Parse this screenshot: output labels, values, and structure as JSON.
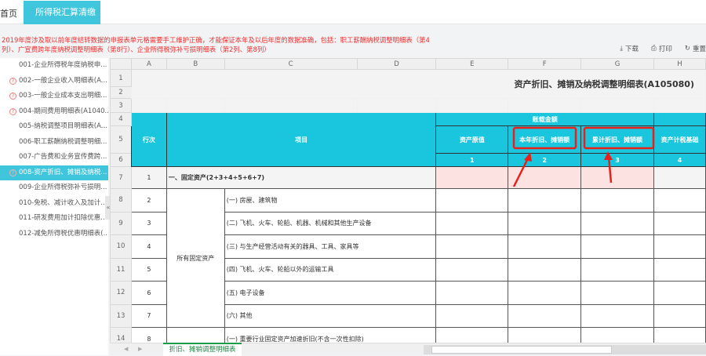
{
  "tabs": {
    "home": "首页",
    "active": "所得税汇算清缴",
    "close": "×"
  },
  "warning": "2019年度涉及取以前年度结转数据的申报表单元格需要手工维护正确，才能保证本年及以后年度的数据准确，包括：职工薪酬纳税调整明细表（第4列）、广宣费跨年度纳税调整明细表（第8行）、企业所得税弥补亏损明细表（第2列、第8列）",
  "toolbar": {
    "download": "下载",
    "print": "打印",
    "reset": "重置"
  },
  "sidebar": {
    "items": [
      {
        "label": "001-企业所得税年度纳税申...",
        "warn": false
      },
      {
        "label": "002-一般企业收入明细表(A...",
        "warn": true
      },
      {
        "label": "003-一般企业成本支出明细...",
        "warn": true
      },
      {
        "label": "004-期间费用明细表(A1040...",
        "warn": true
      },
      {
        "label": "005-纳税调整项目明细表(A...",
        "warn": false
      },
      {
        "label": "006-职工薪酬纳税调整明细...",
        "warn": false
      },
      {
        "label": "007-广告费和业务宣传费跨...",
        "warn": false
      },
      {
        "label": "008-资产折旧、摊销及纳税...",
        "warn": true,
        "active": true
      },
      {
        "label": "009-企业所得税弥补亏损明...",
        "warn": false
      },
      {
        "label": "010-免税、减计收入及加计...",
        "warn": false
      },
      {
        "label": "011-研发费用加计扣除优惠...",
        "warn": false
      },
      {
        "label": "012-减免所得税优惠明细表(...",
        "warn": false
      }
    ],
    "collapse": "«"
  },
  "sheet": {
    "columns": [
      "A",
      "B",
      "C",
      "D",
      "E",
      "F",
      "G",
      "H"
    ],
    "title": "资产折旧、摊销及纳税调整明细表(A105080)",
    "header": {
      "line_no": "行次",
      "item": "项目",
      "group": "账载金额",
      "cols": [
        "资产原值",
        "本年折旧、摊销额",
        "累计折旧、摊销额",
        "资产计税基础"
      ],
      "col_nums": [
        "1",
        "2",
        "3",
        "4"
      ]
    },
    "row7": {
      "line": "1",
      "label": "一、固定资产(2+3+4+5+6+7)"
    },
    "group_label": "所有固定资产",
    "rows": [
      {
        "line": "2",
        "label": "(一) 房屋、建筑物"
      },
      {
        "line": "3",
        "label": "(二) 飞机、火车、轮船、机器、机械和其他生产设备"
      },
      {
        "line": "4",
        "label": "(三) 与生产经营活动有关的器具、工具、家具等"
      },
      {
        "line": "5",
        "label": "(四) 飞机、火车、轮船以外的运输工具"
      },
      {
        "line": "6",
        "label": "(五) 电子设备"
      },
      {
        "line": "7",
        "label": "(六) 其他"
      }
    ],
    "row14": {
      "line": "8",
      "label": "(一) 重要行业固定资产加速折旧(不含一次性扣除)"
    },
    "row_numbers": [
      "1",
      "2",
      "3",
      "4",
      "5",
      "6",
      "7",
      "8",
      "9",
      "10",
      "11",
      "12",
      "13",
      "14"
    ]
  },
  "sheet_tab": "折旧、摊销调整明细表",
  "highlight_color": "#e8201a",
  "accent_color": "#1ac6de"
}
